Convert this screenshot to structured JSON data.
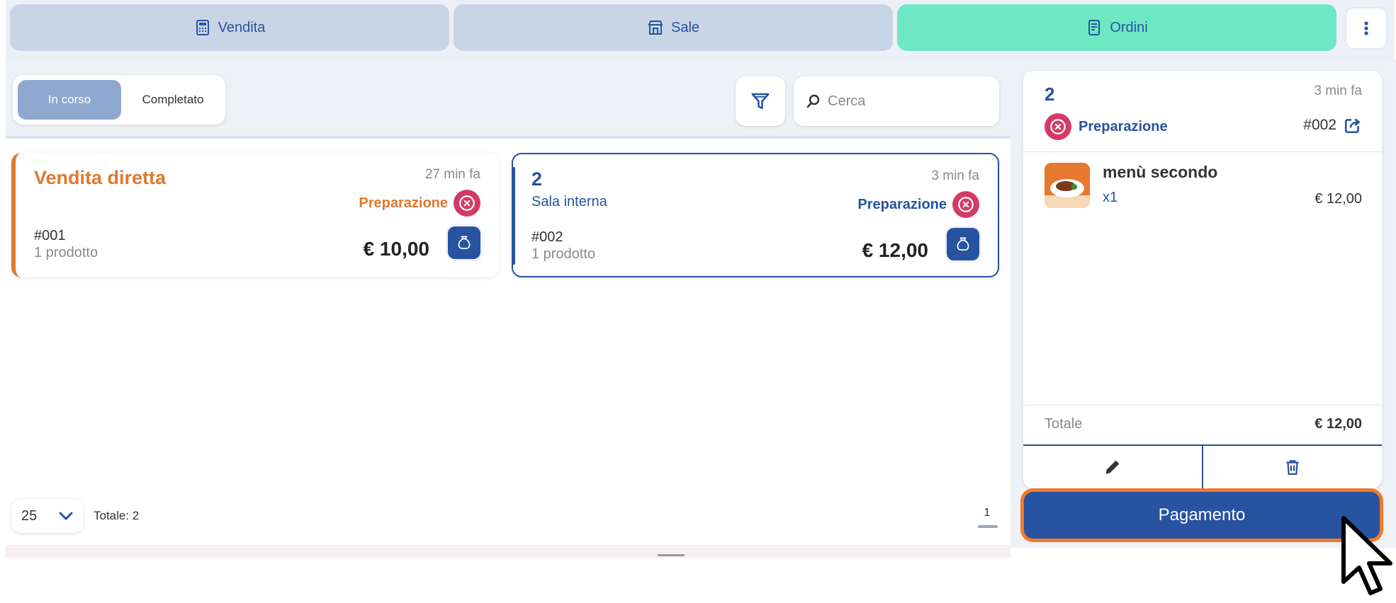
{
  "tabs": [
    {
      "label": "Vendita",
      "icon": "register-icon"
    },
    {
      "label": "Sale",
      "icon": "store-icon"
    },
    {
      "label": "Ordini",
      "icon": "receipt-icon"
    }
  ],
  "filter": {
    "segments": [
      "In corso",
      "Completato"
    ],
    "search_placeholder": "Cerca"
  },
  "orders": [
    {
      "title": "Vendita diretta",
      "subtitle": "",
      "time": "27 min fa",
      "state": "Preparazione",
      "number": "#001",
      "products": "1 prodotto",
      "total": "€ 10,00"
    },
    {
      "title": "2",
      "subtitle": "Sala interna",
      "time": "3 min fa",
      "state": "Preparazione",
      "number": "#002",
      "products": "1 prodotto",
      "total": "€ 12,00"
    }
  ],
  "pager": {
    "page_size": "25",
    "total_label": "Totale: 2",
    "current_page": "1"
  },
  "detail": {
    "table": "2",
    "time": "3 min fa",
    "state": "Preparazione",
    "code": "#002",
    "item": {
      "name": "menù secondo",
      "qty": "x1",
      "price": "€ 12,00"
    },
    "total_label": "Totale",
    "total_value": "€ 12,00",
    "pay_label": "Pagamento"
  },
  "colors": {
    "primary": "#2753a0",
    "accent_active_tab": "#6ee8c2",
    "orange": "#e0782e",
    "cancel_pink": "#d43a66",
    "highlight": "#f07a2b"
  }
}
